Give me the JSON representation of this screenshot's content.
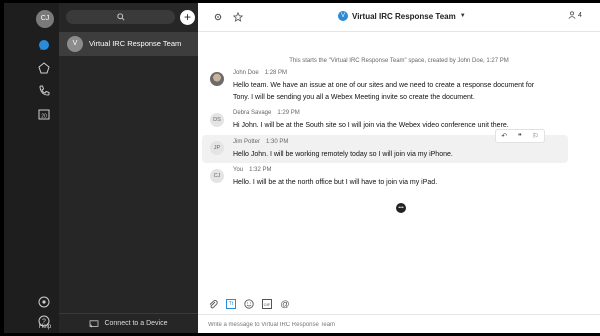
{
  "user": {
    "initials": "CJ"
  },
  "rail": {
    "help_label": "Help",
    "calendar_day": "20"
  },
  "spaces": [
    {
      "initial": "V",
      "name": "Virtual IRC Response Team"
    }
  ],
  "panel": {
    "connect_label": "Connect to a Device"
  },
  "header": {
    "title": "Virtual IRC Response Team",
    "title_initial": "V",
    "participants": "4"
  },
  "system_message": "This starts the \"Virtual IRC Response Team\" space, created by John Doe, 1:27 PM",
  "messages": [
    {
      "initials": "",
      "author": "John Doe",
      "time": "1:28 PM",
      "lines": [
        "Hello team.  We have an issue at one of our sites and we need to create a response document for",
        "Tony.  I will be sending you all a Webex Meeting invite so create the document."
      ]
    },
    {
      "initials": "DS",
      "author": "Debra Savage",
      "time": "1:29 PM",
      "lines": [
        "Hi John.  I will be at the South site so I will join via the Webex video conference unit there."
      ]
    },
    {
      "initials": "JP",
      "author": "Jim Potter",
      "time": "1:30 PM",
      "lines": [
        "Hello John.  I will be working remotely today so I will join via my iPhone."
      ]
    },
    {
      "initials": "CJ",
      "author": "You",
      "time": "1:32 PM",
      "lines": [
        "Hello.  I will be at the north office but I will have to join via my iPad."
      ]
    }
  ],
  "composer": {
    "placeholder": "Write a message to Virtual IRC Response Team",
    "tools": [
      "attach-icon",
      "format-icon",
      "emoji-icon",
      "gif-icon",
      "mention-icon"
    ],
    "format_glyph": "Tt",
    "gif_glyph": "GIF"
  },
  "colors": {
    "rail_bg": "#1e1e1e",
    "panel_bg": "#262626",
    "accent": "#2a8bd8"
  }
}
